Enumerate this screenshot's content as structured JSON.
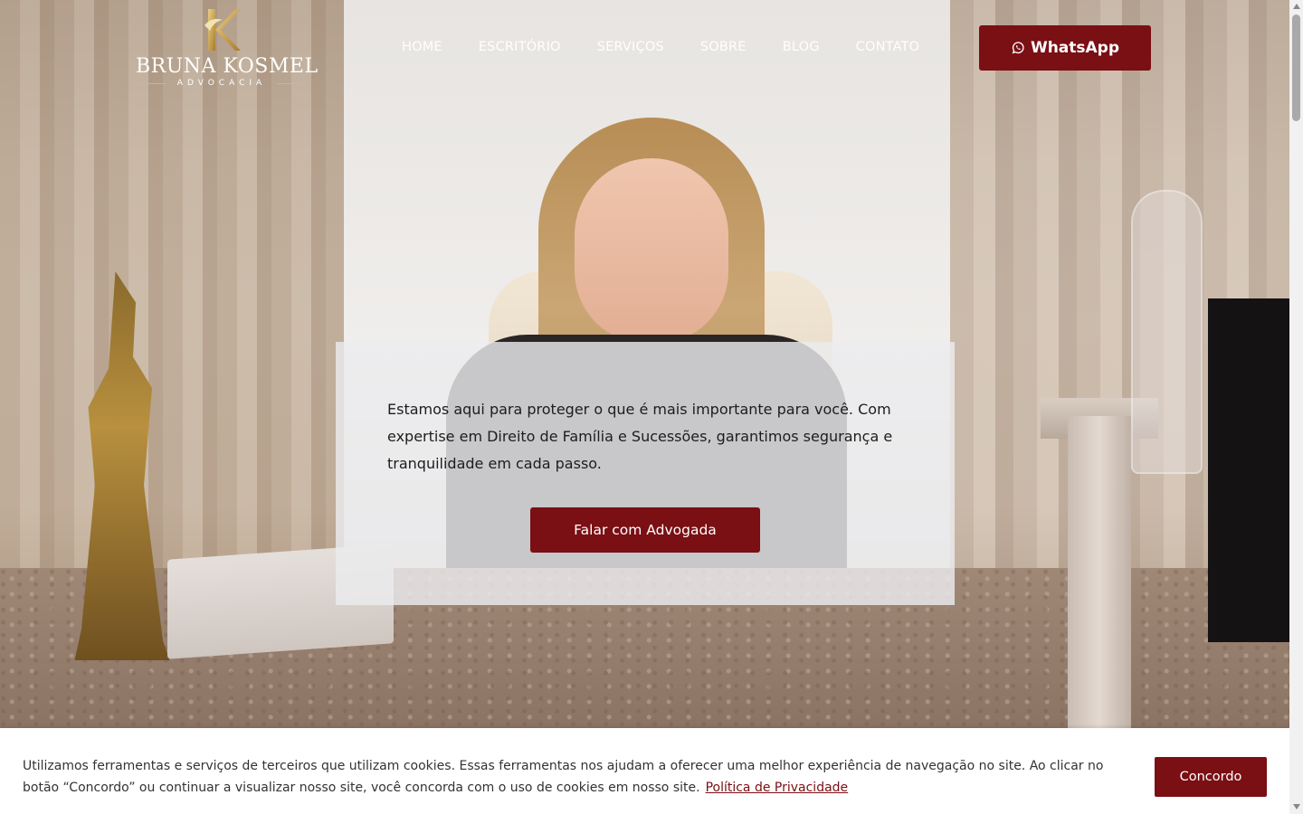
{
  "brand": {
    "name": "BRUNA KOSMEL",
    "subtitle": "ADVOCACIA",
    "gold": "#c9a24c"
  },
  "nav": {
    "items": [
      {
        "label": "HOME"
      },
      {
        "label": "ESCRITÓRIO"
      },
      {
        "label": "SERVIÇOS"
      },
      {
        "label": "SOBRE"
      },
      {
        "label": "BLOG"
      },
      {
        "label": "CONTATO"
      }
    ]
  },
  "header": {
    "whatsapp_label": "WhatsApp",
    "whatsapp_icon": "whatsapp-icon"
  },
  "hero": {
    "text": "Estamos aqui para proteger o que é mais importante para você. Com expertise em Direito de Família e Sucessões, garantimos segurança e tranquilidade em cada passo.",
    "cta_label": "Falar com Advogada"
  },
  "cookie": {
    "text": "Utilizamos ferramentas e serviços de terceiros que utilizam cookies. Essas ferramentas nos ajudam a oferecer uma melhor experiência de navegação no site. Ao clicar no botão “Concordo” ou continuar a visualizar nosso site, você concorda com o uso de cookies em nosso site.",
    "link_label": "Política de Privacidade",
    "agree_label": "Concordo"
  },
  "colors": {
    "accent": "#7a0f14",
    "card_bg": "#ececee",
    "text": "#1d1d1d"
  }
}
